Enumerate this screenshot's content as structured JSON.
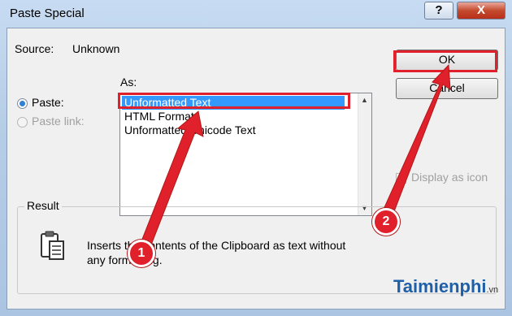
{
  "window": {
    "title": "Paste Special",
    "help_glyph": "?",
    "close_glyph": "X"
  },
  "source": {
    "label": "Source:",
    "value": "Unknown"
  },
  "as_label": "As:",
  "options": {
    "paste_label": "Paste:",
    "paste_link_label": "Paste link:",
    "paste_selected": true
  },
  "formats": {
    "items": [
      "Unformatted Text",
      "HTML Format",
      "Unformatted Unicode Text"
    ],
    "selected_index": 0
  },
  "buttons": {
    "ok": "OK",
    "cancel": "Cancel"
  },
  "display_as_icon": {
    "label": "Display as icon",
    "checked": false
  },
  "result": {
    "title": "Result",
    "line1": "Inserts the contents of the Clipboard as text without",
    "line2": "any formatting."
  },
  "annotations": {
    "step1": "1",
    "step2": "2",
    "arrow_color": "#e0202a"
  },
  "watermark": {
    "brand": "Taimienphi",
    "suffix": ".vn"
  }
}
